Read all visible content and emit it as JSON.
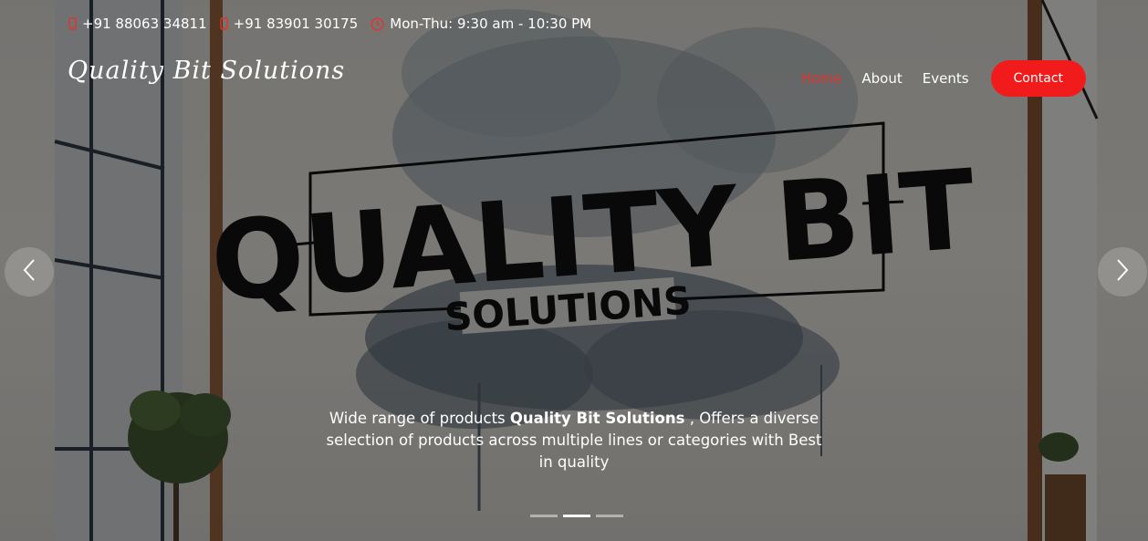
{
  "topbar": {
    "phone1": "+91 88063 34811",
    "phone2": "+91 83901 30175",
    "hours": "Mon-Thu: 9:30 am - 10:30 PM",
    "icons": {
      "phone": "phone-icon",
      "clock": "clock-icon"
    },
    "icon_color": "#e6322a"
  },
  "brand": {
    "name": "Quality Bit Solutions"
  },
  "nav": {
    "items": [
      {
        "label": "Home",
        "active": true
      },
      {
        "label": "About",
        "active": false
      },
      {
        "label": "Events",
        "active": false
      }
    ],
    "contact_label": "Contact"
  },
  "hero": {
    "sign_line1": "QUALITY BIT",
    "sign_line2": "SOLUTIONS",
    "caption_before": "Wide range of products ",
    "caption_bold": "Quality Bit Solutions",
    "caption_after": " , Offers a diverse selection of products across multiple lines or categories with Best in quality",
    "prev_icon": "chevron-left-icon",
    "next_icon": "chevron-right-icon"
  },
  "carousel": {
    "slide_count": 3,
    "active_index": 1
  },
  "colors": {
    "accent": "#f21b1b",
    "active_nav": "#e6322a"
  }
}
